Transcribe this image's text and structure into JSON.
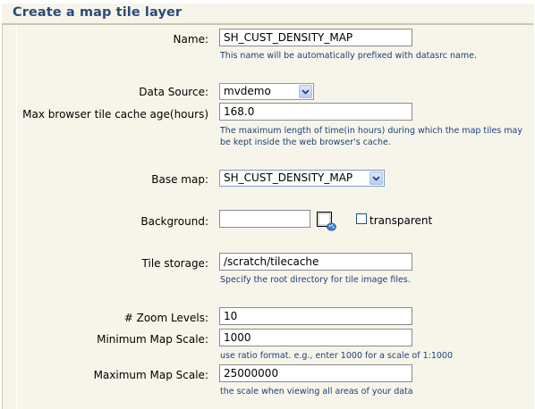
{
  "title": "Create a map tile layer",
  "name": {
    "label": "Name:",
    "value": "SH_CUST_DENSITY_MAP",
    "hint": "This name will be automatically prefixed with datasrc name."
  },
  "data_source": {
    "label": "Data Source:",
    "value": "mvdemo"
  },
  "cache_age": {
    "label": "Max browser tile cache age(hours)",
    "value": "168.0",
    "hint_line1": "The maximum length of time(in hours) during which the map tiles may",
    "hint_line2": "be kept inside the web browser's cache."
  },
  "base_map": {
    "label": "Base map:",
    "value": "SH_CUST_DENSITY_MAP"
  },
  "background": {
    "label": "Background:",
    "value": "",
    "transparent_label": "transparent",
    "transparent_checked": false
  },
  "tile_storage": {
    "label": "Tile storage:",
    "value": "/scratch/tilecache",
    "hint": "Specify the root directory for tile image files."
  },
  "zoom_levels": {
    "label": "# Zoom Levels:",
    "value": "10"
  },
  "min_scale": {
    "label": "Minimum Map Scale:",
    "value": "1000",
    "hint": "use ratio format. e.g., enter 1000 for a scale of 1:1000"
  },
  "max_scale": {
    "label": "Maximum Map Scale:",
    "value": "25000000",
    "hint": "the scale when viewing all areas of your data"
  },
  "icons": {
    "dropdown": "chevron-down-icon",
    "color_picker": "palette-icon"
  },
  "colors": {
    "title": "#2b4a7a",
    "hint": "#1a3f7a",
    "panel": "#f7f5ea"
  }
}
